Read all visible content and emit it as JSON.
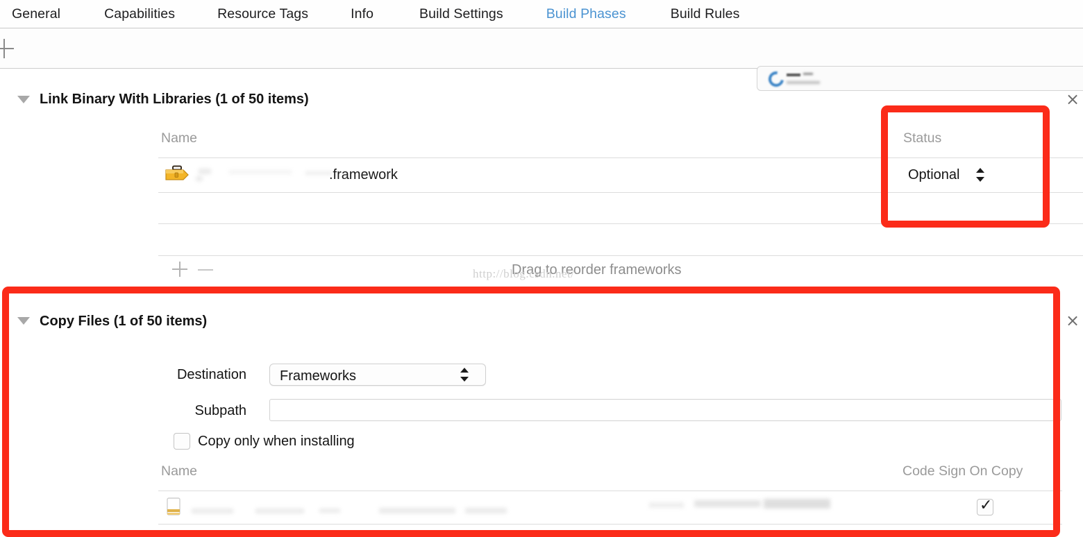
{
  "tabs": [
    {
      "label": "General",
      "active": false
    },
    {
      "label": "Capabilities",
      "active": false
    },
    {
      "label": "Resource Tags",
      "active": false
    },
    {
      "label": "Info",
      "active": false
    },
    {
      "label": "Build Settings",
      "active": false
    },
    {
      "label": "Build Phases",
      "active": true
    },
    {
      "label": "Build Rules",
      "active": false
    }
  ],
  "toolbar": {
    "add_icon": "plus-icon",
    "filter_placeholder": "",
    "filter_value": "",
    "clear_icon": "clear-icon"
  },
  "sections": [
    {
      "id": "link-binary",
      "title": "Link Binary With Libraries (1 of 50 items)",
      "disclosure_icon": "triangle-down-icon",
      "close_icon": "close-icon",
      "columns": {
        "name": "Name",
        "status": "Status"
      },
      "rows": [
        {
          "icon": "framework-briefcase-icon",
          "name": ".framework",
          "name_redacted": true,
          "status": "Optional",
          "status_icon": "stepper-updown-icon"
        }
      ],
      "footer": {
        "add_icon": "plus-icon",
        "remove_icon": "minus-icon",
        "hint": "Drag to reorder frameworks"
      }
    },
    {
      "id": "copy-files",
      "title": "Copy Files (1 of 50 items)",
      "disclosure_icon": "triangle-down-icon",
      "close_icon": "close-icon",
      "fields": {
        "destination_label": "Destination",
        "destination_value": "Frameworks",
        "destination_icon": "stepper-updown-icon",
        "subpath_label": "Subpath",
        "subpath_value": "",
        "copy_only_label": "Copy only when installing",
        "copy_only_checked": false
      },
      "columns": {
        "name": "Name",
        "code_sign": "Code Sign On Copy"
      },
      "rows": [
        {
          "icon": "file-icon",
          "name": "",
          "name_redacted": true,
          "code_sign_checked": true,
          "check_glyph": "✓"
        }
      ]
    }
  ],
  "annotations": [
    {
      "id": "status-highlight",
      "color": "#fb2b19"
    },
    {
      "id": "copy-files-highlight",
      "color": "#fb2b19"
    }
  ],
  "watermark": {
    "text": "http://blog.csdn.net/"
  }
}
